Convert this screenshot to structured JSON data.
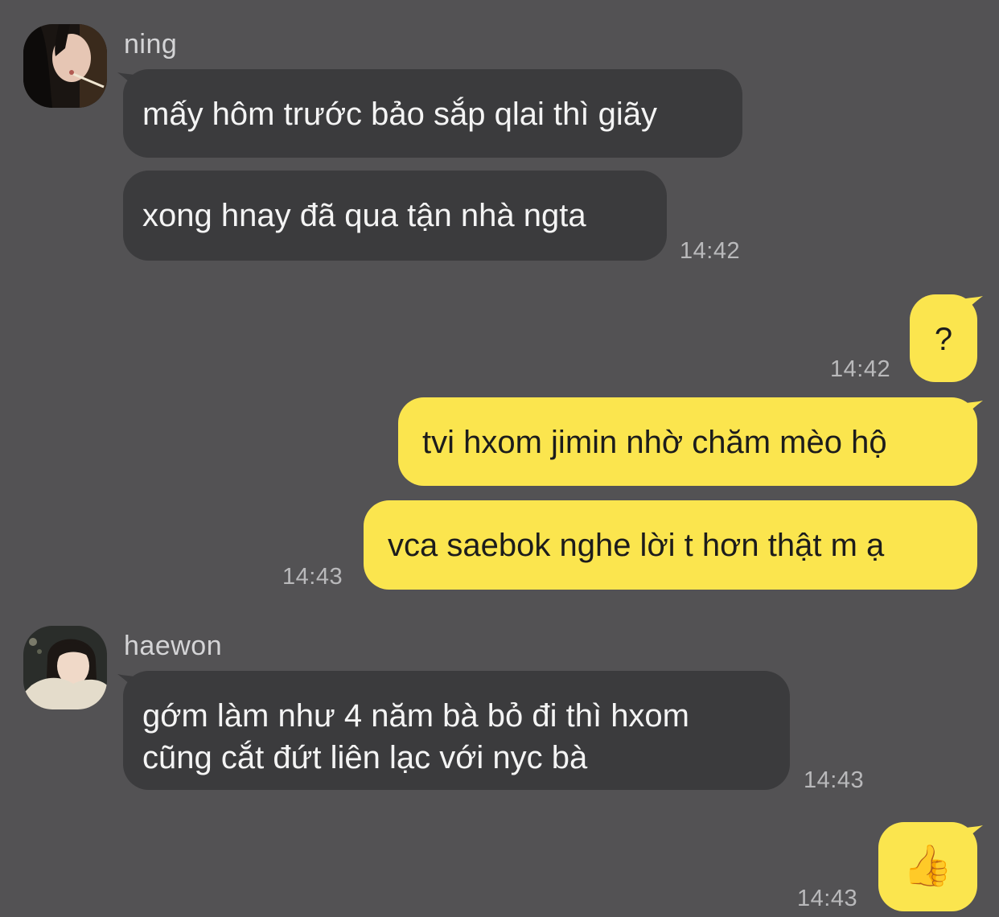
{
  "messages": [
    {
      "sender": "ning",
      "text": "mấy hôm trước bảo sắp qlai thì giãy"
    },
    {
      "text": "xong hnay đã qua tận nhà ngta",
      "time": "14:42"
    },
    {
      "text": "?",
      "time": "14:42",
      "outgoing": true
    },
    {
      "text": "tvi hxom jimin nhờ chăm mèo hộ",
      "outgoing": true
    },
    {
      "text": "vca saebok nghe lời t hơn thật m ạ",
      "time": "14:43",
      "outgoing": true
    },
    {
      "sender": "haewon",
      "lines": [
        "gớm làm như 4 năm bà bỏ đi thì hxom",
        "cũng cắt đứt liên lạc với nyc bà"
      ],
      "time": "14:43"
    },
    {
      "emoji": "👍",
      "time": "14:43",
      "outgoing": true
    }
  ],
  "colors": {
    "background": "#535254",
    "incoming_bubble": "#3b3b3d",
    "outgoing_bubble": "#fbe54e"
  }
}
